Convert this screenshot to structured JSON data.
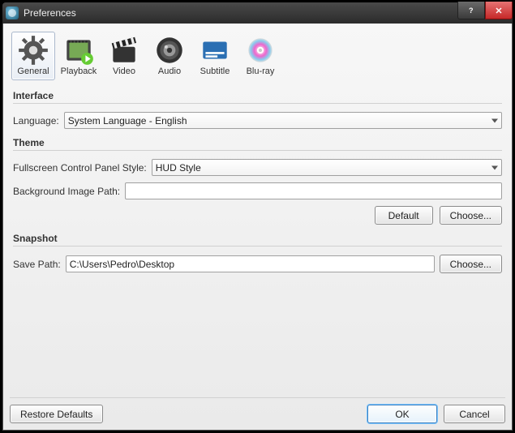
{
  "window": {
    "title": "Preferences"
  },
  "tabs": [
    {
      "label": "General"
    },
    {
      "label": "Playback"
    },
    {
      "label": "Video"
    },
    {
      "label": "Audio"
    },
    {
      "label": "Subtitle"
    },
    {
      "label": "Blu-ray"
    }
  ],
  "interface": {
    "heading": "Interface",
    "language_label": "Language:",
    "language_value": "System Language - English"
  },
  "theme": {
    "heading": "Theme",
    "fcp_label": "Fullscreen Control Panel Style:",
    "fcp_value": "HUD Style",
    "bg_label": "Background Image Path:",
    "bg_value": "",
    "default_btn": "Default",
    "choose_btn": "Choose..."
  },
  "snapshot": {
    "heading": "Snapshot",
    "save_label": "Save Path:",
    "save_value": "C:\\Users\\Pedro\\Desktop",
    "choose_btn": "Choose..."
  },
  "footer": {
    "restore": "Restore Defaults",
    "ok": "OK",
    "cancel": "Cancel"
  }
}
